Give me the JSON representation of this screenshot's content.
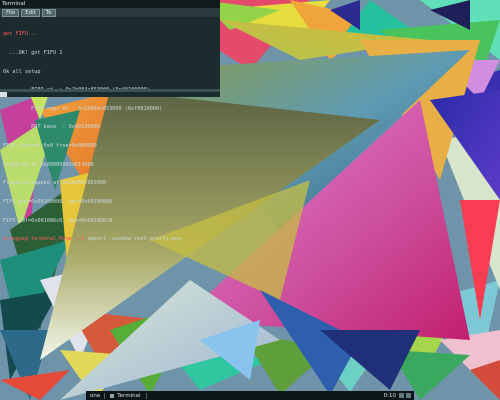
{
  "terminal": {
    "window_title": "Terminal",
    "menu": [
      "File",
      "Edit",
      "Te"
    ],
    "lines": [
      {
        "text": "get FIFO...",
        "color": "red"
      },
      {
        "text": "  ...OK! got FIFO 1",
        "color": "normal"
      },
      {
        "text": "Ok all setup",
        "color": "normal"
      },
      {
        "text": "         FIFO at  : 0x2b084c853000 (0xf0100000)",
        "color": "normal"
      },
      {
        "text": "         FIFO regs at : 0x2b084c853000 (0xf0810000)",
        "color": "normal"
      },
      {
        "text": "         PUT base  : 0x00130000",
        "color": "normal"
      },
      {
        "text": "FIFO current:0x0 free=0x400000",
        "color": "normal"
      },
      {
        "text": "Fragprog at 0x00000000d014800",
        "color": "normal"
      },
      {
        "text": "Fragprog mapped at 0x2b084c963000",
        "color": "normal"
      },
      {
        "text": "FIFO put=0x00100000, get=0x00100000",
        "color": "normal"
      },
      {
        "text": "FIFO put=0x001006c0, get=0x001006c0",
        "color": "normal"
      }
    ],
    "prompt": "arnegoe@ terminal_Home ~ $",
    "command": " import -window root pretty.png"
  },
  "taskbar": {
    "workspace": "one",
    "task_label": "Terminal",
    "clock": "0:10"
  },
  "colors": {
    "desktop": "#6f93a8",
    "terminal_bg": "#1c2b2e",
    "prompt_red": "#ff5b62"
  }
}
